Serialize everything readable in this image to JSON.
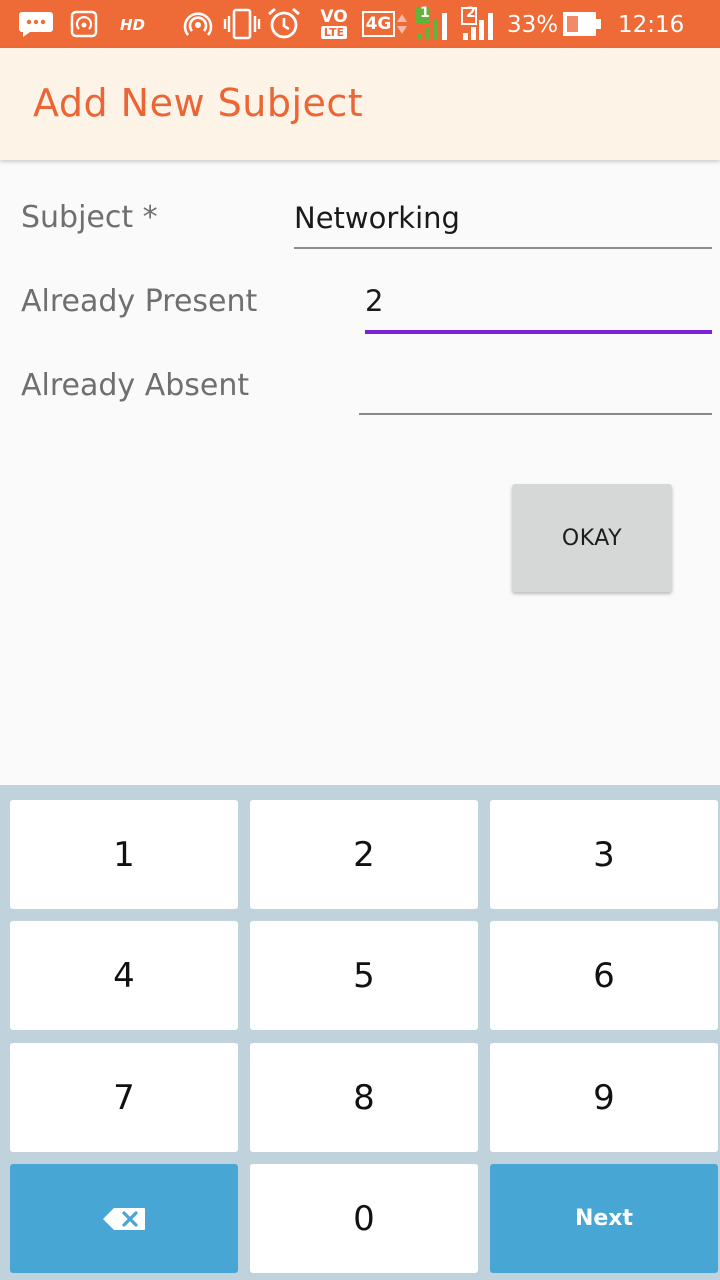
{
  "status_bar": {
    "hd_label": "HD",
    "volte_label": "VO",
    "lte_label": "LTE",
    "network_label": "4G",
    "sim1_label": "1",
    "sim2_label": "2",
    "battery_percent": "33%",
    "time": "12:16 AM",
    "background_color": "#ee6a37"
  },
  "app_bar": {
    "title": "Add New Subject",
    "title_color": "#ec6535"
  },
  "form": {
    "subject_label": "Subject *",
    "subject_value": "Networking",
    "present_label": "Already Present",
    "present_value": "2",
    "absent_label": "Already Absent",
    "absent_value": "",
    "active_underline_color": "#7b22d6"
  },
  "okay_button": {
    "label": "OKAY"
  },
  "keypad": {
    "keys": [
      "1",
      "2",
      "3",
      "4",
      "5",
      "6",
      "7",
      "8",
      "9"
    ],
    "zero": "0",
    "next_label": "Next",
    "backspace_icon": "backspace-icon",
    "action_color": "#47a6d4"
  }
}
